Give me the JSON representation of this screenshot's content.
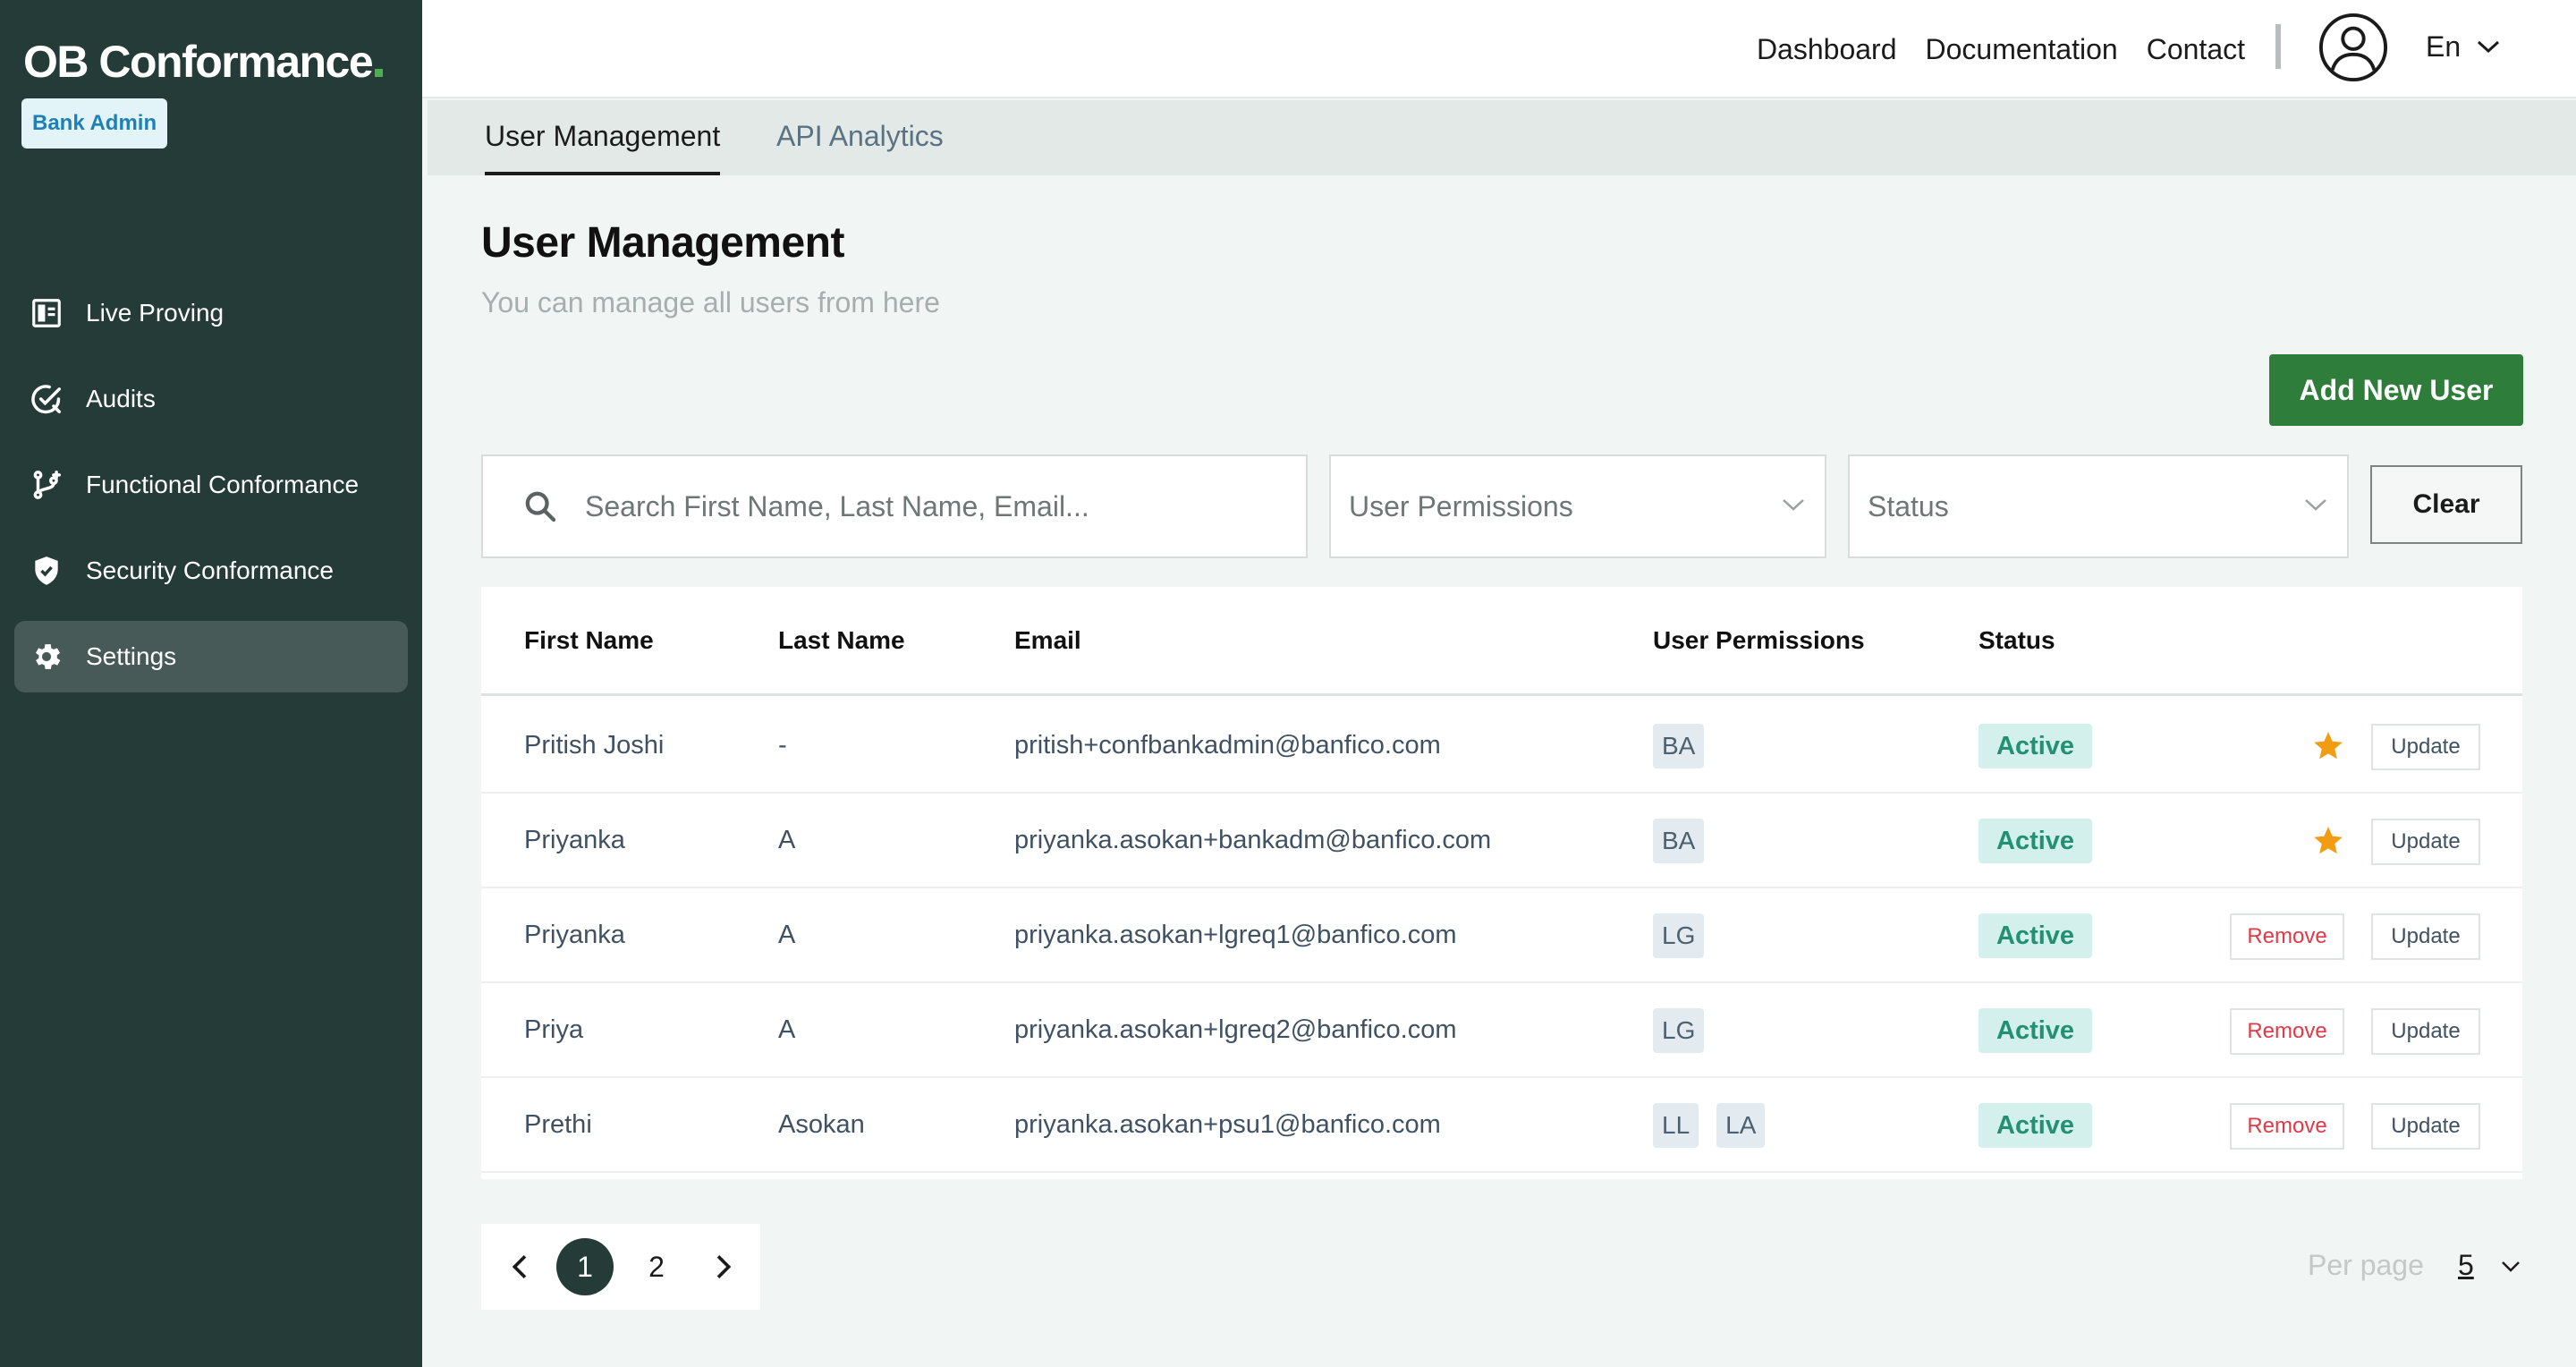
{
  "sidebar": {
    "brand": "OB Conformance",
    "role_badge": "Bank Admin",
    "items": [
      {
        "label": "Live Proving",
        "icon": "dashboard-icon"
      },
      {
        "label": "Audits",
        "icon": "audit-check-icon"
      },
      {
        "label": "Functional Conformance",
        "icon": "git-branch-icon"
      },
      {
        "label": "Security Conformance",
        "icon": "shield-check-icon"
      },
      {
        "label": "Settings",
        "icon": "gear-icon",
        "active": true
      }
    ]
  },
  "topbar": {
    "links": [
      "Dashboard",
      "Documentation",
      "Contact"
    ],
    "language": "En"
  },
  "tabs": [
    {
      "label": "User Management",
      "active": true
    },
    {
      "label": "API Analytics",
      "active": false
    }
  ],
  "page": {
    "title": "User Management",
    "subtitle": "You can manage all users from here",
    "add_button": "Add New User"
  },
  "filters": {
    "search_placeholder": "Search First Name, Last Name, Email...",
    "permissions_select": "User Permissions",
    "status_select": "Status",
    "clear_button": "Clear"
  },
  "table": {
    "columns": [
      "First Name",
      "Last Name",
      "Email",
      "User Permissions",
      "Status"
    ],
    "rows": [
      {
        "first": "Pritish Joshi",
        "last": "-",
        "email": "pritish+confbankadmin@banfico.com",
        "perms": [
          "BA"
        ],
        "status": "Active",
        "starred": true,
        "remove": null,
        "update": "Update"
      },
      {
        "first": "Priyanka",
        "last": "A",
        "email": "priyanka.asokan+bankadm@banfico.com",
        "perms": [
          "BA"
        ],
        "status": "Active",
        "starred": true,
        "remove": null,
        "update": "Update"
      },
      {
        "first": "Priyanka",
        "last": "A",
        "email": "priyanka.asokan+lgreq1@banfico.com",
        "perms": [
          "LG"
        ],
        "status": "Active",
        "starred": false,
        "remove": "Remove",
        "update": "Update"
      },
      {
        "first": "Priya",
        "last": "A",
        "email": "priyanka.asokan+lgreq2@banfico.com",
        "perms": [
          "LG"
        ],
        "status": "Active",
        "starred": false,
        "remove": "Remove",
        "update": "Update"
      },
      {
        "first": "Prethi",
        "last": "Asokan",
        "email": "priyanka.asokan+psu1@banfico.com",
        "perms": [
          "LL",
          "LA"
        ],
        "status": "Active",
        "starred": false,
        "remove": "Remove",
        "update": "Update"
      }
    ]
  },
  "pagination": {
    "pages": [
      "1",
      "2"
    ],
    "current": "1",
    "per_page_label": "Per page",
    "per_page_value": "5"
  },
  "colors": {
    "sidebar_bg": "#253b38",
    "primary_green": "#2e7d3a",
    "status_active_bg": "#d4f0ec",
    "status_active_text": "#229071",
    "remove_red": "#e23947",
    "star_orange": "#f39c12"
  }
}
